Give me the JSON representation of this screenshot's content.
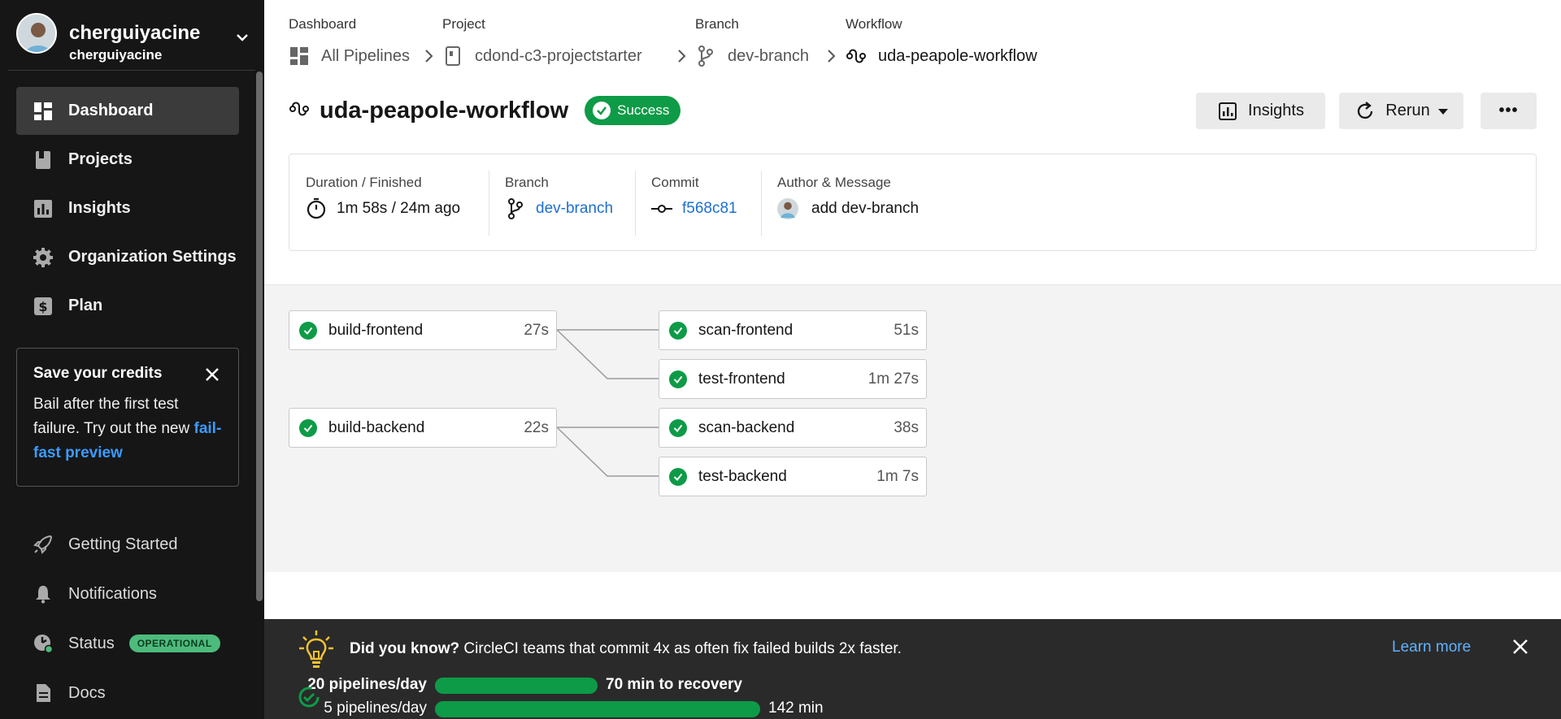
{
  "sidebar": {
    "org_name": "cherguiyacine",
    "org_sub": "cherguiyacine",
    "nav": [
      {
        "label": "Dashboard",
        "icon": "dashboard-icon",
        "active": true
      },
      {
        "label": "Projects",
        "icon": "projects-icon"
      },
      {
        "label": "Insights",
        "icon": "insights-icon"
      },
      {
        "label": "Organization Settings",
        "icon": "gear-icon"
      },
      {
        "label": "Plan",
        "icon": "dollar-icon"
      }
    ],
    "credits": {
      "title": "Save your credits",
      "text": "Bail after the first test failure. Try out the new ",
      "link": "fail-fast preview"
    },
    "nav_bottom": [
      {
        "label": "Getting Started",
        "icon": "rocket-icon"
      },
      {
        "label": "Notifications",
        "icon": "bell-icon"
      },
      {
        "label": "Status",
        "icon": "status-icon",
        "badge": "OPERATIONAL"
      },
      {
        "label": "Docs",
        "icon": "docs-icon"
      }
    ]
  },
  "breadcrumb": {
    "labels": [
      "Dashboard",
      "Project",
      "Branch",
      "Workflow"
    ],
    "items": [
      "All Pipelines",
      "cdond-c3-projectstarter",
      "dev-branch",
      "uda-peapole-workflow"
    ]
  },
  "workflow": {
    "title": "uda-peapole-workflow",
    "status": "Success",
    "insights_label": "Insights",
    "rerun_label": "Rerun",
    "more_label": "•••"
  },
  "meta": {
    "duration_label": "Duration / Finished",
    "duration_value": "1m 58s / 24m ago",
    "branch_label": "Branch",
    "branch_value": "dev-branch",
    "commit_label": "Commit",
    "commit_value": "f568c81",
    "author_label": "Author & Message",
    "author_value": "add dev-branch"
  },
  "jobs": [
    {
      "name": "build-frontend",
      "duration": "27s"
    },
    {
      "name": "scan-frontend",
      "duration": "51s"
    },
    {
      "name": "test-frontend",
      "duration": "1m 27s"
    },
    {
      "name": "build-backend",
      "duration": "22s"
    },
    {
      "name": "scan-backend",
      "duration": "38s"
    },
    {
      "name": "test-backend",
      "duration": "1m 7s"
    }
  ],
  "banner": {
    "dyk_bold": "Did you know?",
    "dyk_text": " CircleCI teams that commit 4x as often fix failed builds 2x faster.",
    "learn_more": "Learn more",
    "stats": [
      {
        "label": "20 pipelines/day",
        "result": "70 min to recovery"
      },
      {
        "label": "5 pipelines/day",
        "result": "142 min"
      }
    ]
  },
  "colors": {
    "success": "#0d9b47",
    "link": "#1f6fcf",
    "sidebar_bg": "#161616"
  }
}
